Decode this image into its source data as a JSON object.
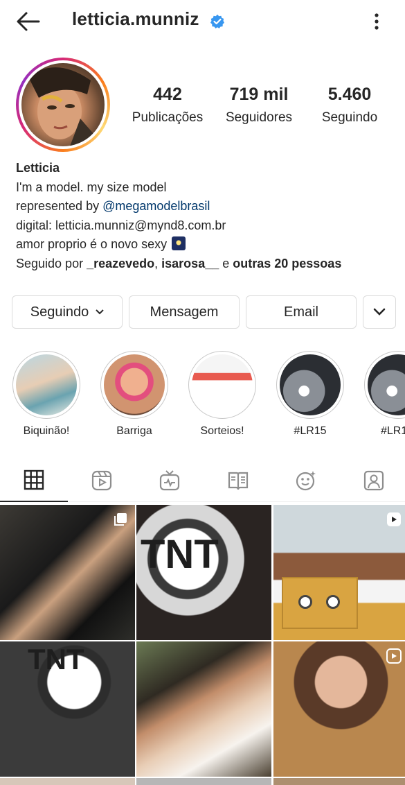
{
  "header": {
    "username": "letticia.munniz",
    "back_icon": "arrow-left-icon",
    "verified_icon": "verified-badge-icon",
    "more_icon": "more-vertical-icon"
  },
  "stats": {
    "posts_value": "442",
    "posts_label": "Publicações",
    "followers_value": "719 mil",
    "followers_label": "Seguidores",
    "following_value": "5.460",
    "following_label": "Seguindo"
  },
  "bio": {
    "name": "Letticia",
    "line1": "I'm a model. my size model",
    "line2_prefix": "represented by ",
    "line2_mention": "@megamodelbrasil",
    "line3": "digital: letticia.munniz@mynd8.com.br",
    "line4": "amor proprio é o novo sexy",
    "line4_emoji": "sparkles-night-icon",
    "line5_prefix": "Seguido por ",
    "line5_user1": "_reazevedo",
    "line5_sep": ", ",
    "line5_user2": "isarosa__",
    "line5_mid": " e ",
    "line5_others": "outras 20 pessoas"
  },
  "actions": {
    "following_label": "Seguindo",
    "message_label": "Mensagem",
    "email_label": "Email",
    "more_icon": "chevron-down-icon"
  },
  "highlights": [
    {
      "label": "Biquinão!"
    },
    {
      "label": "Barriga"
    },
    {
      "label": "Sorteios!"
    },
    {
      "label": "#LR15"
    },
    {
      "label": "#LR1"
    }
  ],
  "tabs": [
    {
      "icon": "grid-icon",
      "active": true
    },
    {
      "icon": "reels-icon",
      "active": false
    },
    {
      "icon": "igtv-icon",
      "active": false
    },
    {
      "icon": "guides-icon",
      "active": false
    },
    {
      "icon": "effects-icon",
      "active": false
    },
    {
      "icon": "tagged-icon",
      "active": false
    }
  ],
  "grid": {
    "post_text_tnt": "TNT",
    "badges": [
      "carousel-icon",
      "",
      "reels-icon",
      "",
      "",
      "reels-icon"
    ]
  },
  "colors": {
    "text": "#262626",
    "mention": "#00376b",
    "verified": "#3897f0",
    "border": "#dbdbdb"
  }
}
